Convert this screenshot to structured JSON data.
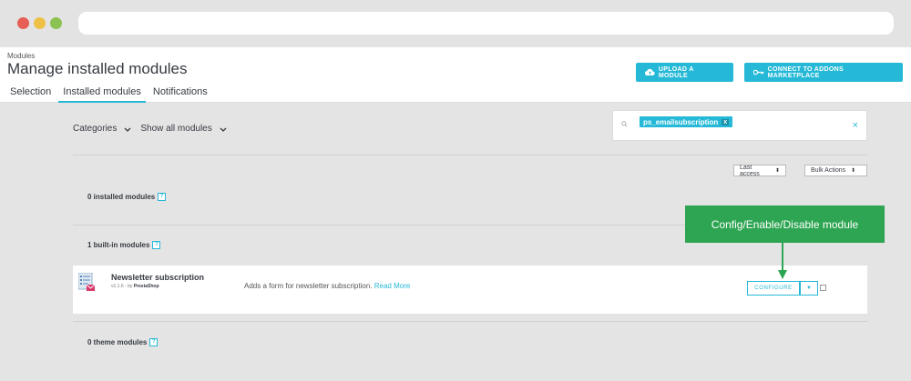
{
  "header": {
    "breadcrumb": "Modules",
    "title": "Manage installed modules",
    "upload_label": "UPLOAD A MODULE",
    "connect_label": "CONNECT TO ADDONS MARKETPLACE"
  },
  "tabs": [
    "Selection",
    "Installed modules",
    "Notifications"
  ],
  "filters": {
    "categories": "Categories",
    "show": "Show all modules"
  },
  "search": {
    "tag": "ps_emailsubscription",
    "tag_remove": "x",
    "clear": "×"
  },
  "sort": {
    "last_access": "Last access",
    "bulk_actions": "Bulk Actions"
  },
  "sections": {
    "installed": "0 installed modules",
    "builtin": "1 built-in modules",
    "theme": "0 theme modules",
    "help": "?"
  },
  "module": {
    "name": "Newsletter subscription",
    "version": "v1.1.6 - by",
    "author": "PrestaShop",
    "description": "Adds a form for newsletter subscription.",
    "read_more": "Read More",
    "configure": "CONFIGURE"
  },
  "callout": "Config/Enable/Disable module",
  "colors": {
    "accent": "#25b9d7",
    "callout": "#2ea552"
  }
}
